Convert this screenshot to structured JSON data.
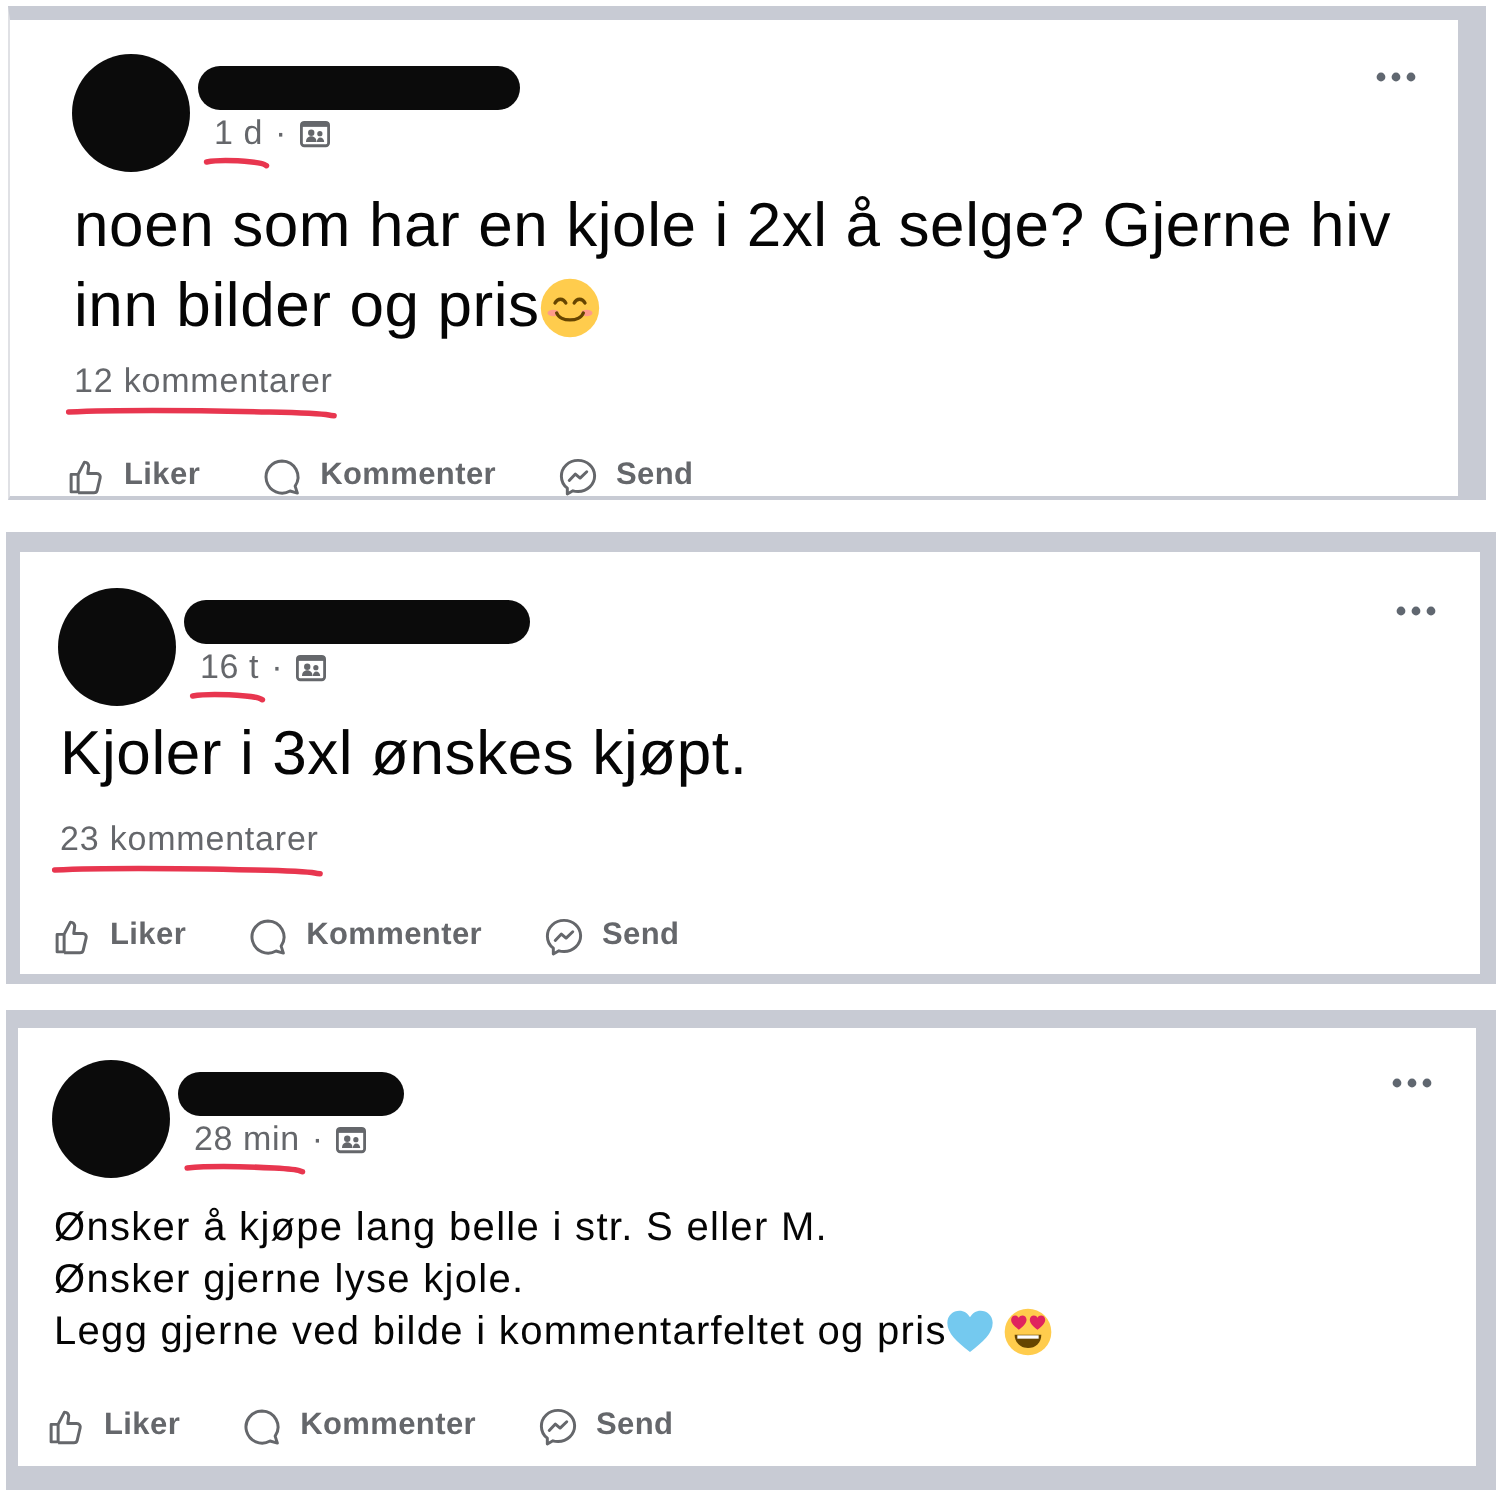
{
  "posts": [
    {
      "time": {
        "text": "1 d",
        "underlined": true
      },
      "separator": "·",
      "lines": [
        "noen som har en kjole i 2xl å selge? Gjerne hiv",
        "inn bilder og pris"
      ],
      "emoji": [
        {
          "kind": "smiling"
        }
      ],
      "comments": {
        "text": "12 kommentarer",
        "underlined": true
      },
      "actions": [
        {
          "kind": "like",
          "label": "Liker"
        },
        {
          "kind": "comment",
          "label": "Kommenter"
        },
        {
          "kind": "send",
          "label": "Send"
        }
      ]
    },
    {
      "time": {
        "text": "16 t",
        "underlined": true
      },
      "separator": "·",
      "lines": [
        "Kjoler i 3xl ønskes kjøpt."
      ],
      "comments": {
        "text": "23 kommentarer",
        "underlined": true
      },
      "actions": [
        {
          "kind": "like",
          "label": "Liker"
        },
        {
          "kind": "comment",
          "label": "Kommenter"
        },
        {
          "kind": "send",
          "label": "Send"
        }
      ]
    },
    {
      "time": {
        "text": "28 min",
        "underlined": true
      },
      "separator": "·",
      "lines": [
        "Ønsker å kjøpe lang belle i str. S eller M.",
        "Ønsker gjerne lyse kjole.",
        "Legg gjerne ved bilde i kommentarfeltet og pris"
      ],
      "emoji": [
        {
          "kind": "heart"
        },
        {
          "kind": "heart_eyes"
        }
      ],
      "actions": [
        {
          "kind": "like",
          "label": "Liker"
        },
        {
          "kind": "comment",
          "label": "Kommenter"
        },
        {
          "kind": "send",
          "label": "Send"
        }
      ]
    }
  ]
}
